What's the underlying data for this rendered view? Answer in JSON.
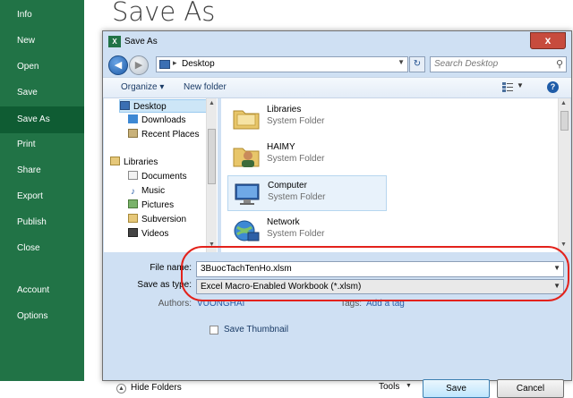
{
  "backstage": {
    "items": [
      {
        "label": "Info"
      },
      {
        "label": "New"
      },
      {
        "label": "Open"
      },
      {
        "label": "Save"
      },
      {
        "label": "Save As",
        "active": true
      },
      {
        "label": "Print"
      },
      {
        "label": "Share"
      },
      {
        "label": "Export"
      },
      {
        "label": "Publish"
      },
      {
        "label": "Close"
      },
      {
        "label": "Account"
      },
      {
        "label": "Options"
      }
    ],
    "page_title": "Save As",
    "color": "#217346"
  },
  "dialog": {
    "title": "Save As",
    "close_label": "x",
    "address": {
      "location": "Desktop"
    },
    "search_placeholder": "Search Desktop",
    "toolbar": {
      "organize": "Organize ▾",
      "new_folder": "New folder",
      "help": "?"
    },
    "nav_pane": [
      {
        "label": "Desktop",
        "icon": "desktop-icon",
        "selected": true
      },
      {
        "label": "Downloads",
        "icon": "downloads-icon"
      },
      {
        "label": "Recent Places",
        "icon": "recent-places-icon"
      },
      {
        "label": "Libraries",
        "icon": "libraries-icon"
      },
      {
        "label": "Documents",
        "icon": "documents-icon"
      },
      {
        "label": "Music",
        "icon": "music-icon"
      },
      {
        "label": "Pictures",
        "icon": "pictures-icon"
      },
      {
        "label": "Subversion",
        "icon": "subversion-icon"
      },
      {
        "label": "Videos",
        "icon": "videos-icon"
      }
    ],
    "files": [
      {
        "name": "Libraries",
        "type": "System Folder",
        "icon": "libraries-folder-icon"
      },
      {
        "name": "HAIMY",
        "type": "System Folder",
        "icon": "user-folder-icon"
      },
      {
        "name": "Computer",
        "type": "System Folder",
        "icon": "computer-icon",
        "selected": true
      },
      {
        "name": "Network",
        "type": "System Folder",
        "icon": "network-icon"
      }
    ],
    "file_name_label": "File name:",
    "file_name_value": "3BuocTachTenHo.xlsm",
    "save_as_type_label": "Save as type:",
    "save_as_type_value": "Excel Macro-Enabled Workbook (*.xlsm)",
    "authors_label": "Authors:",
    "authors_value": "VUONGHAI",
    "tags_label": "Tags:",
    "tags_value": "Add a tag",
    "save_thumbnail_label": "Save Thumbnail",
    "hide_folders_label": "Hide Folders",
    "tools_label": "Tools",
    "save_label": "Save",
    "cancel_label": "Cancel"
  },
  "highlight_color": "#e3221b"
}
